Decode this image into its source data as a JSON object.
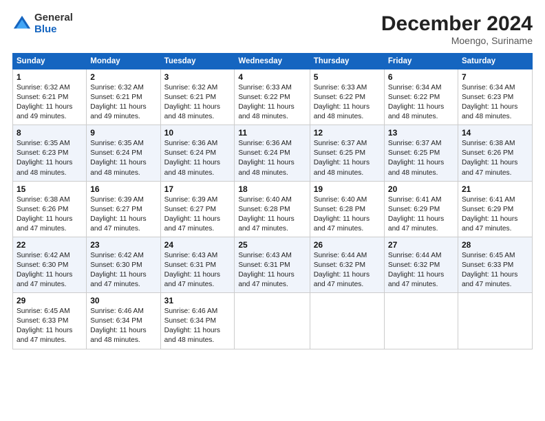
{
  "logo": {
    "general": "General",
    "blue": "Blue"
  },
  "title": "December 2024",
  "location": "Moengo, Suriname",
  "days_of_week": [
    "Sunday",
    "Monday",
    "Tuesday",
    "Wednesday",
    "Thursday",
    "Friday",
    "Saturday"
  ],
  "weeks": [
    [
      {
        "day": "1",
        "sunrise": "6:32 AM",
        "sunset": "6:21 PM",
        "daylight": "11 hours and 49 minutes."
      },
      {
        "day": "2",
        "sunrise": "6:32 AM",
        "sunset": "6:21 PM",
        "daylight": "11 hours and 49 minutes."
      },
      {
        "day": "3",
        "sunrise": "6:32 AM",
        "sunset": "6:21 PM",
        "daylight": "11 hours and 48 minutes."
      },
      {
        "day": "4",
        "sunrise": "6:33 AM",
        "sunset": "6:22 PM",
        "daylight": "11 hours and 48 minutes."
      },
      {
        "day": "5",
        "sunrise": "6:33 AM",
        "sunset": "6:22 PM",
        "daylight": "11 hours and 48 minutes."
      },
      {
        "day": "6",
        "sunrise": "6:34 AM",
        "sunset": "6:22 PM",
        "daylight": "11 hours and 48 minutes."
      },
      {
        "day": "7",
        "sunrise": "6:34 AM",
        "sunset": "6:23 PM",
        "daylight": "11 hours and 48 minutes."
      }
    ],
    [
      {
        "day": "8",
        "sunrise": "6:35 AM",
        "sunset": "6:23 PM",
        "daylight": "11 hours and 48 minutes."
      },
      {
        "day": "9",
        "sunrise": "6:35 AM",
        "sunset": "6:24 PM",
        "daylight": "11 hours and 48 minutes."
      },
      {
        "day": "10",
        "sunrise": "6:36 AM",
        "sunset": "6:24 PM",
        "daylight": "11 hours and 48 minutes."
      },
      {
        "day": "11",
        "sunrise": "6:36 AM",
        "sunset": "6:24 PM",
        "daylight": "11 hours and 48 minutes."
      },
      {
        "day": "12",
        "sunrise": "6:37 AM",
        "sunset": "6:25 PM",
        "daylight": "11 hours and 48 minutes."
      },
      {
        "day": "13",
        "sunrise": "6:37 AM",
        "sunset": "6:25 PM",
        "daylight": "11 hours and 48 minutes."
      },
      {
        "day": "14",
        "sunrise": "6:38 AM",
        "sunset": "6:26 PM",
        "daylight": "11 hours and 47 minutes."
      }
    ],
    [
      {
        "day": "15",
        "sunrise": "6:38 AM",
        "sunset": "6:26 PM",
        "daylight": "11 hours and 47 minutes."
      },
      {
        "day": "16",
        "sunrise": "6:39 AM",
        "sunset": "6:27 PM",
        "daylight": "11 hours and 47 minutes."
      },
      {
        "day": "17",
        "sunrise": "6:39 AM",
        "sunset": "6:27 PM",
        "daylight": "11 hours and 47 minutes."
      },
      {
        "day": "18",
        "sunrise": "6:40 AM",
        "sunset": "6:28 PM",
        "daylight": "11 hours and 47 minutes."
      },
      {
        "day": "19",
        "sunrise": "6:40 AM",
        "sunset": "6:28 PM",
        "daylight": "11 hours and 47 minutes."
      },
      {
        "day": "20",
        "sunrise": "6:41 AM",
        "sunset": "6:29 PM",
        "daylight": "11 hours and 47 minutes."
      },
      {
        "day": "21",
        "sunrise": "6:41 AM",
        "sunset": "6:29 PM",
        "daylight": "11 hours and 47 minutes."
      }
    ],
    [
      {
        "day": "22",
        "sunrise": "6:42 AM",
        "sunset": "6:30 PM",
        "daylight": "11 hours and 47 minutes."
      },
      {
        "day": "23",
        "sunrise": "6:42 AM",
        "sunset": "6:30 PM",
        "daylight": "11 hours and 47 minutes."
      },
      {
        "day": "24",
        "sunrise": "6:43 AM",
        "sunset": "6:31 PM",
        "daylight": "11 hours and 47 minutes."
      },
      {
        "day": "25",
        "sunrise": "6:43 AM",
        "sunset": "6:31 PM",
        "daylight": "11 hours and 47 minutes."
      },
      {
        "day": "26",
        "sunrise": "6:44 AM",
        "sunset": "6:32 PM",
        "daylight": "11 hours and 47 minutes."
      },
      {
        "day": "27",
        "sunrise": "6:44 AM",
        "sunset": "6:32 PM",
        "daylight": "11 hours and 47 minutes."
      },
      {
        "day": "28",
        "sunrise": "6:45 AM",
        "sunset": "6:33 PM",
        "daylight": "11 hours and 47 minutes."
      }
    ],
    [
      {
        "day": "29",
        "sunrise": "6:45 AM",
        "sunset": "6:33 PM",
        "daylight": "11 hours and 47 minutes."
      },
      {
        "day": "30",
        "sunrise": "6:46 AM",
        "sunset": "6:34 PM",
        "daylight": "11 hours and 48 minutes."
      },
      {
        "day": "31",
        "sunrise": "6:46 AM",
        "sunset": "6:34 PM",
        "daylight": "11 hours and 48 minutes."
      },
      null,
      null,
      null,
      null
    ]
  ]
}
